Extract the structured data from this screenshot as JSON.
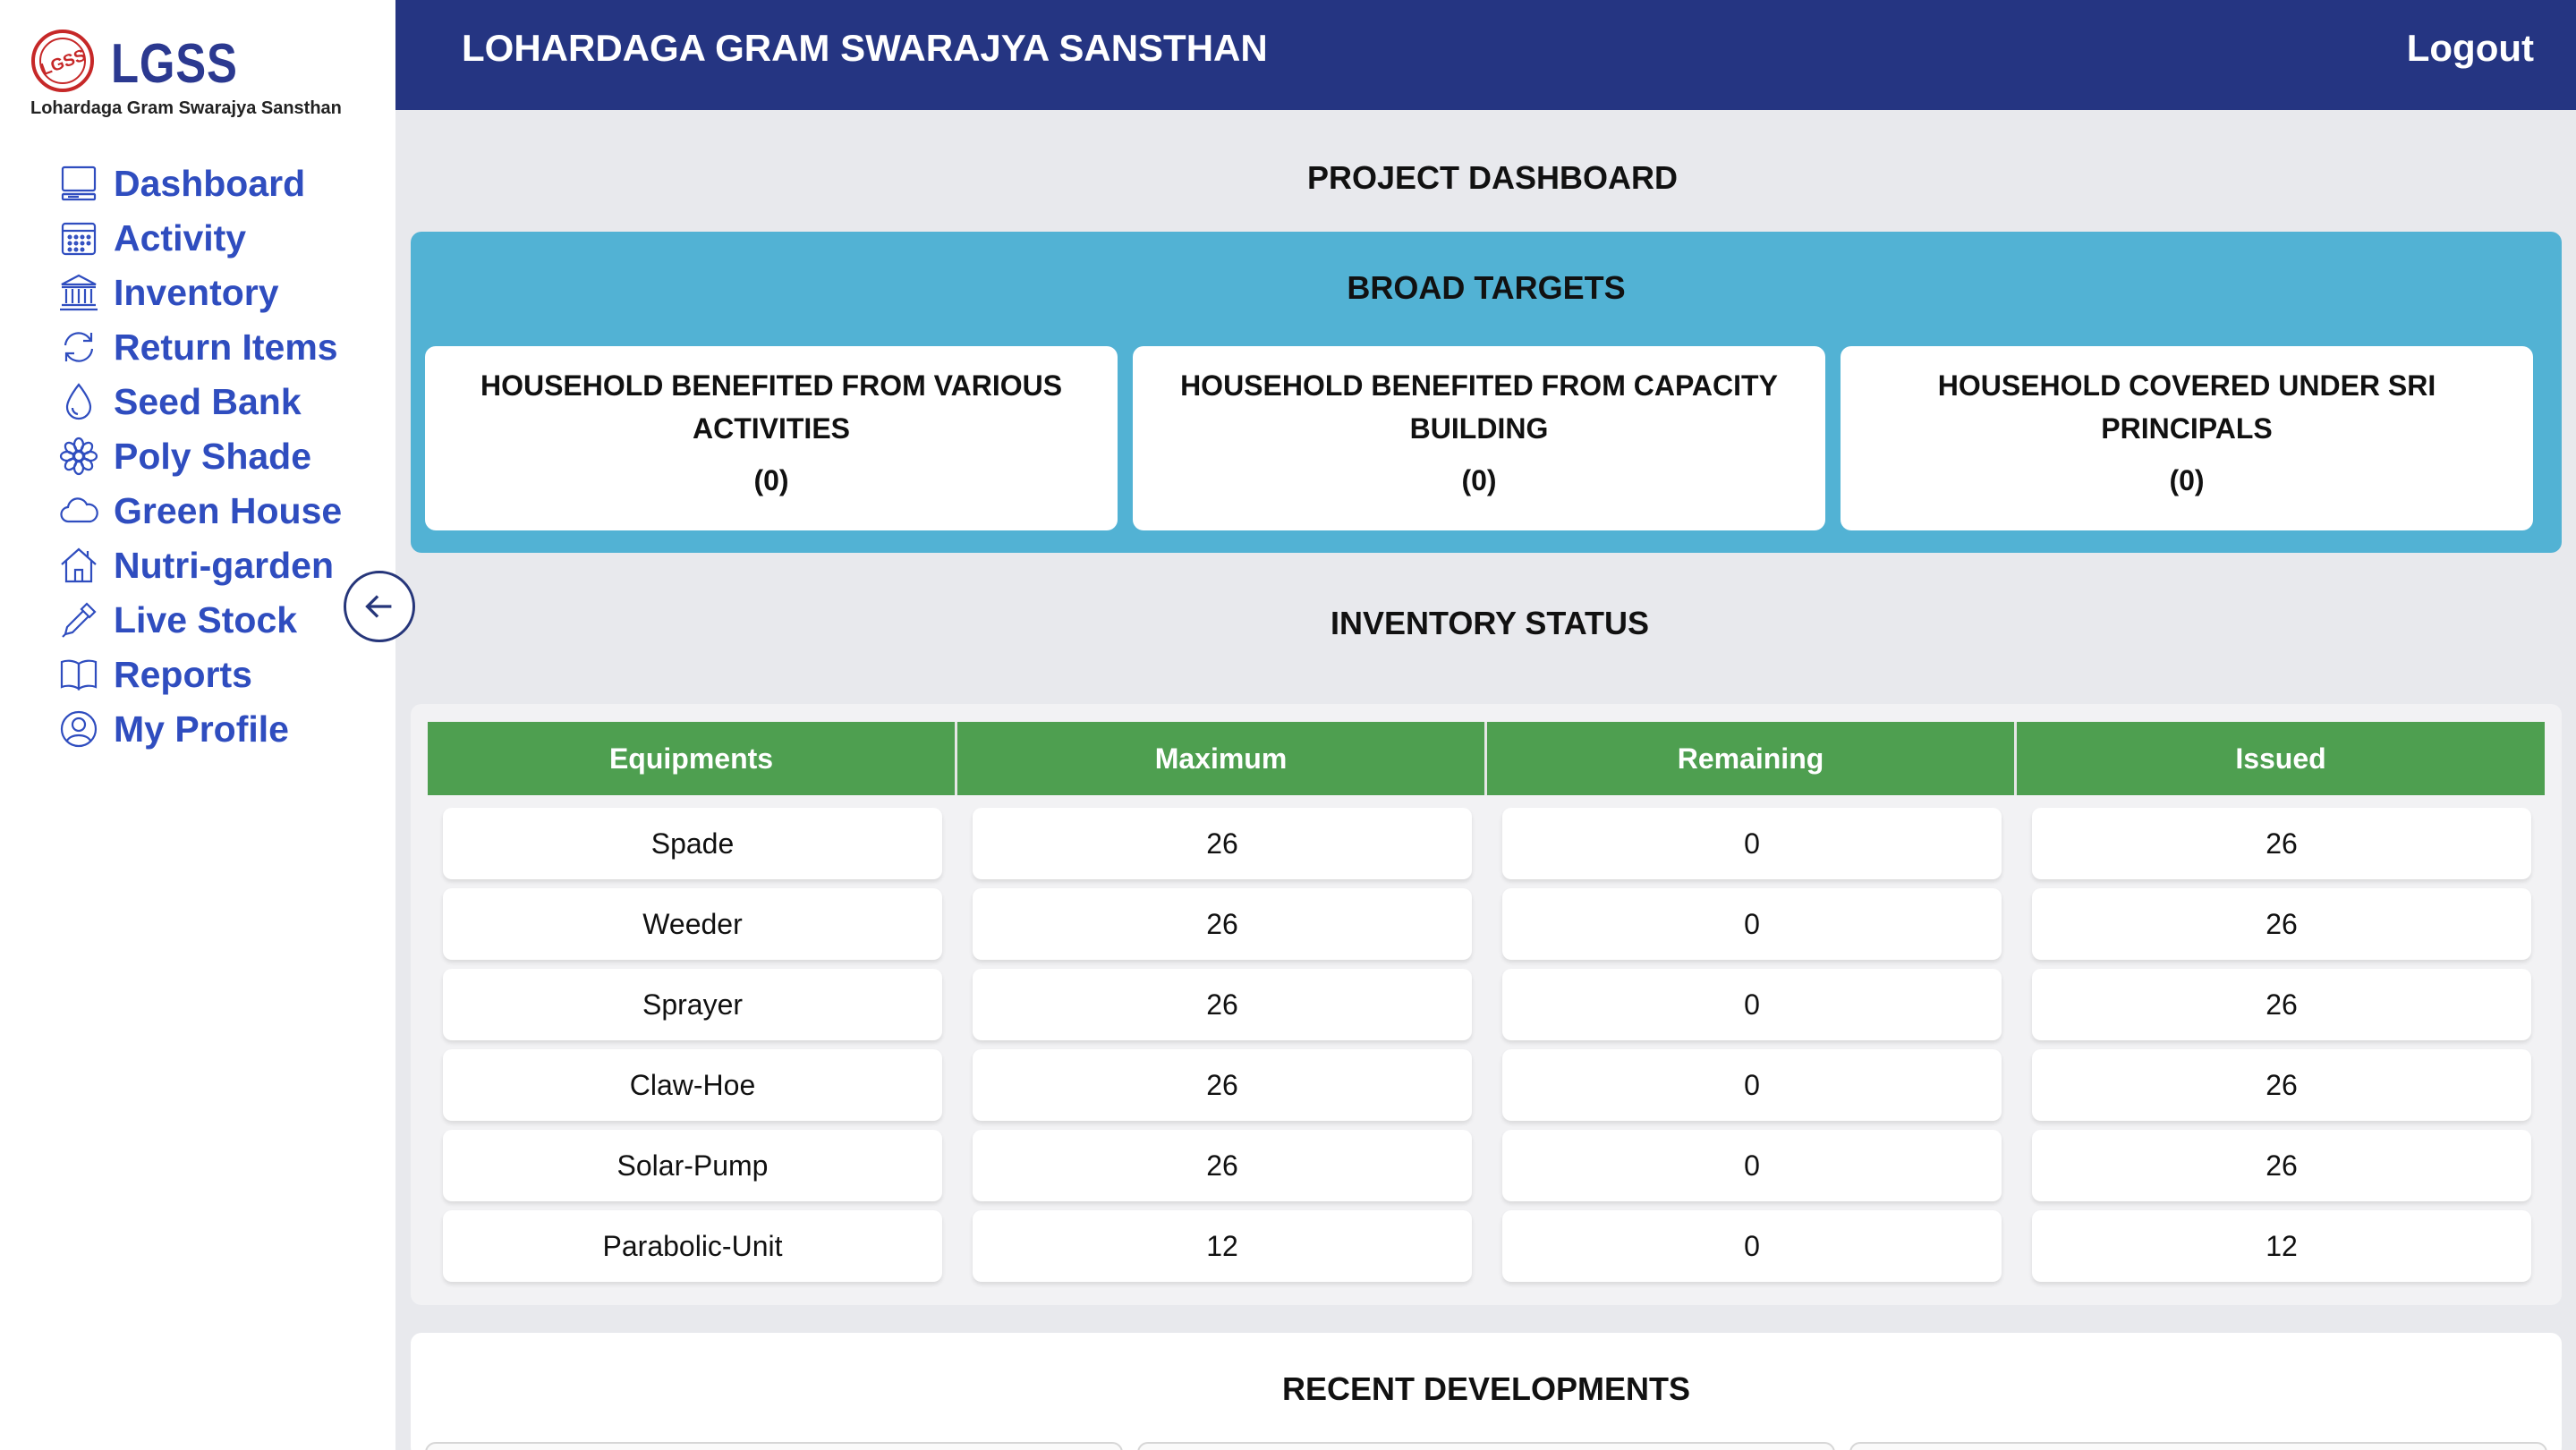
{
  "brand": {
    "logo_text": "LGSS",
    "logo_sub": "Lohardaga Gram Swarajya Sansthan",
    "mark_text": "LGSS",
    "brand_color": "#2b3990",
    "mark_color": "#c62828"
  },
  "sidebar": {
    "items": [
      {
        "label": "Dashboard",
        "icon": "monitor-icon"
      },
      {
        "label": "Activity",
        "icon": "calendar-icon"
      },
      {
        "label": "Inventory",
        "icon": "bank-icon"
      },
      {
        "label": "Return Items",
        "icon": "refresh-icon"
      },
      {
        "label": "Seed Bank",
        "icon": "droplet-icon"
      },
      {
        "label": "Poly Shade",
        "icon": "flower-icon"
      },
      {
        "label": "Green House",
        "icon": "cloud-icon"
      },
      {
        "label": "Nutri-garden",
        "icon": "house-icon"
      },
      {
        "label": "Live Stock",
        "icon": "eyedropper-icon"
      },
      {
        "label": "Reports",
        "icon": "book-icon"
      },
      {
        "label": "My Profile",
        "icon": "user-circle-icon"
      }
    ],
    "accent": "#2f4dbf"
  },
  "header": {
    "title": "LOHARDAGA GRAM SWARAJYA SANSTHAN",
    "logout": "Logout",
    "bg": "#253582"
  },
  "main": {
    "page_title": "PROJECT DASHBOARD",
    "broad_targets": {
      "title": "BROAD TARGETS",
      "cards": [
        {
          "title": "HOUSEHOLD BENEFITED FROM VARIOUS ACTIVITIES",
          "value": "(0)"
        },
        {
          "title": "HOUSEHOLD BENEFITED FROM CAPACITY BUILDING",
          "value": "(0)"
        },
        {
          "title": "HOUSEHOLD COVERED UNDER SRI PRINCIPALS",
          "value": "(0)"
        }
      ],
      "bg": "#52b2d4"
    },
    "inventory": {
      "title": "INVENTORY STATUS",
      "columns": [
        "Equipments",
        "Maximum",
        "Remaining",
        "Issued"
      ],
      "rows": [
        [
          "Spade",
          "26",
          "0",
          "26"
        ],
        [
          "Weeder",
          "26",
          "0",
          "26"
        ],
        [
          "Sprayer",
          "26",
          "0",
          "26"
        ],
        [
          "Claw-Hoe",
          "26",
          "0",
          "26"
        ],
        [
          "Solar-Pump",
          "26",
          "0",
          "26"
        ],
        [
          "Parabolic-Unit",
          "12",
          "0",
          "12"
        ]
      ],
      "header_bg": "#4e9f50"
    },
    "recent": {
      "title": "RECENT DEVELOPMENTS"
    }
  }
}
